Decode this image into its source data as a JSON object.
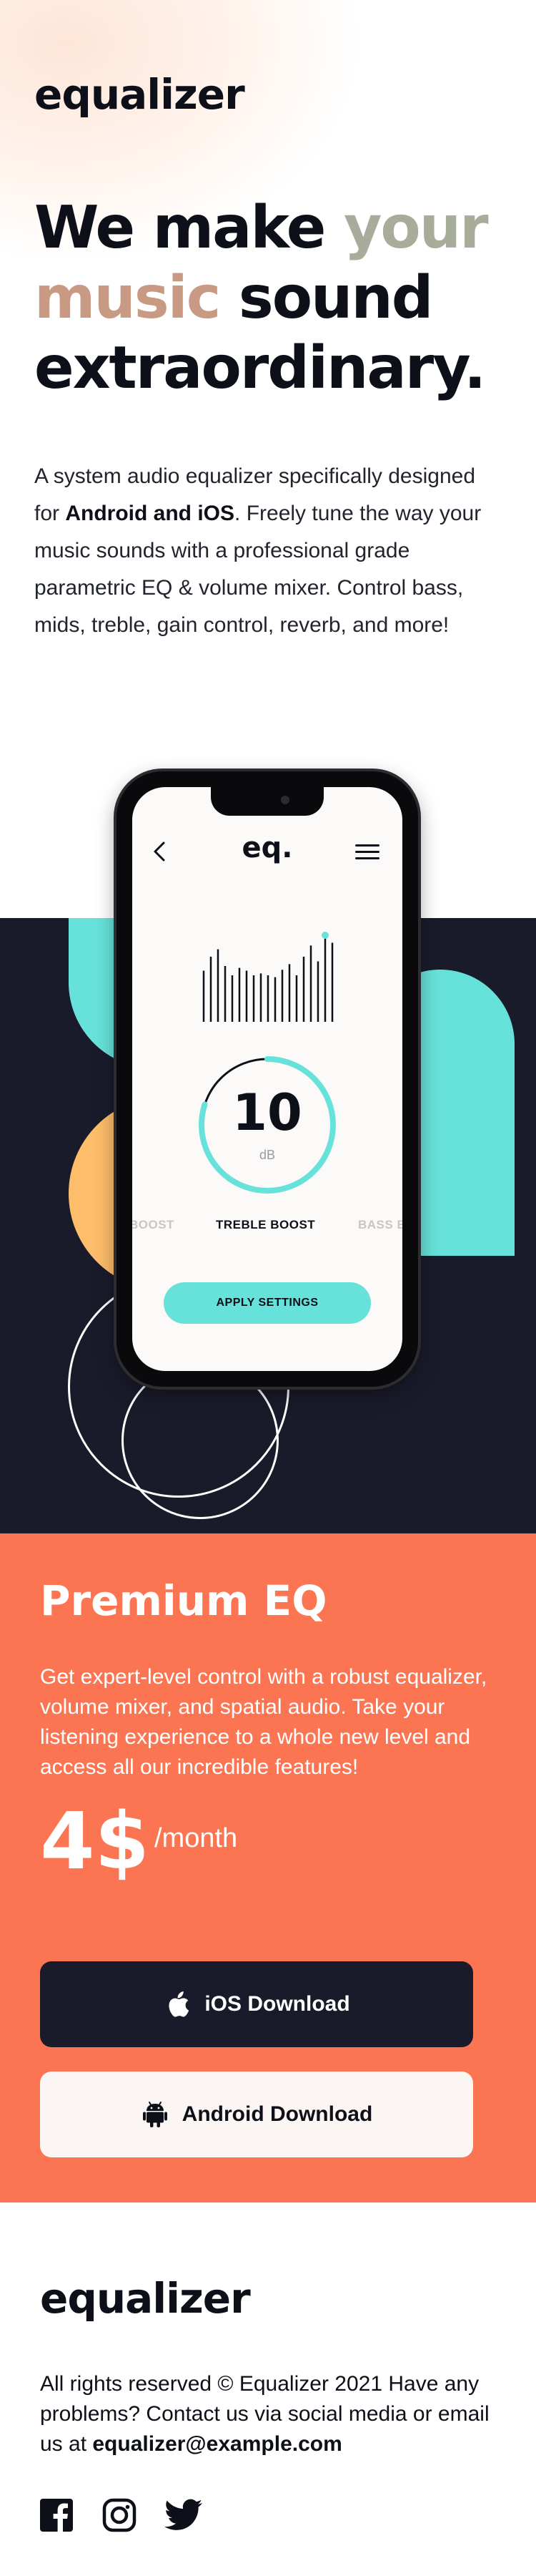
{
  "brand": {
    "logo": "equalizer"
  },
  "hero": {
    "headline_part1": "We make ",
    "headline_your": "your",
    "headline_music": "music",
    "headline_part2": " sound extraordinary.",
    "intro_part1": "A system audio equalizer specifically designed for ",
    "intro_bold": "Android and iOS",
    "intro_part2": ". Freely tune the way your music sounds with a professional grade parametric EQ & volume mixer. Control bass, mids, treble, gain control, reverb, and more!"
  },
  "phone_app": {
    "logo": "eq.",
    "back_icon": "chevron-left-icon",
    "menu_icon": "hamburger-menu-icon",
    "dial_value": "10",
    "dial_unit": "dB",
    "dial_fraction": 0.8,
    "presets": [
      "BOOST",
      "TREBLE BOOST",
      "BASS B"
    ],
    "active_preset": "TREBLE BOOST",
    "apply_label": "APPLY SETTINGS",
    "eq_bar_levels": [
      0.55,
      0.7,
      0.78,
      0.6,
      0.5,
      0.58,
      0.55,
      0.5,
      0.52,
      0.5,
      0.48,
      0.56,
      0.62,
      0.5,
      0.7,
      0.82,
      0.65,
      0.9,
      0.85
    ]
  },
  "premium": {
    "title": "Premium EQ",
    "text": "Get expert-level control with a robust equalizer, volume mixer, and spatial audio. Take your listening experience to a whole new level and access all our incredible features!",
    "price": "4$",
    "per": "/month",
    "ios_label": "iOS Download",
    "android_label": "Android Download",
    "ios_icon": "apple-icon",
    "android_icon": "android-icon"
  },
  "footer": {
    "logo": "equalizer",
    "text_part1": "All rights reserved © Equalizer 2021 Have any problems? Contact us via social media or email us at ",
    "email": "equalizer@example.com",
    "social_icons": [
      "facebook-icon",
      "instagram-icon",
      "twitter-icon"
    ]
  },
  "colors": {
    "dark": "#1a1b2a",
    "teal": "#67e2da",
    "orange": "#fdbd6a",
    "coral": "#fb7552",
    "sage": "#a8ad9b",
    "tan": "#c99a83"
  }
}
